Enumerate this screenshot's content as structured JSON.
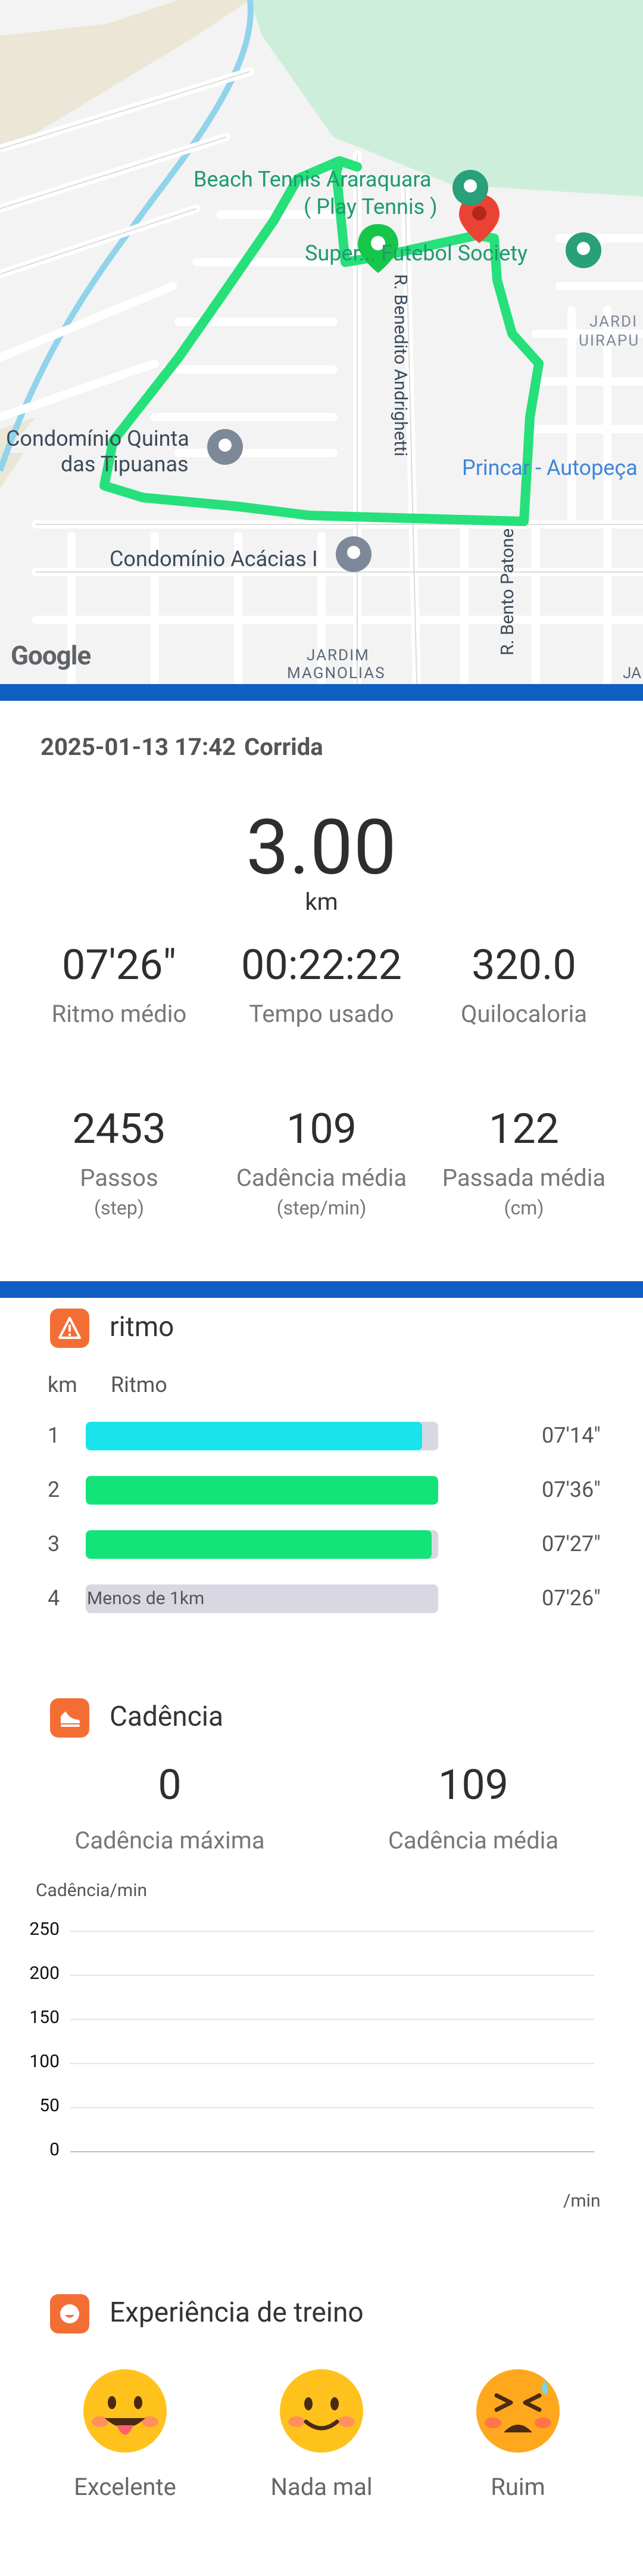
{
  "map": {
    "labels": {
      "beach": "Beach Tennis Araraquara",
      "play": "( Play Tennis )",
      "futebol": "Super... Futebol Society",
      "benedito": "R. Benedito Andrighetti",
      "jardim_uira": "JARDI",
      "jardim_uira2": "UIRAPU",
      "condominio_quinta": "Condomínio Quinta",
      "das_tipuanas": "das Tipuanas",
      "princar": "Princar - Autopeça",
      "acacias": "Condomínio Acácias I",
      "bento": "R. Bento Patone",
      "jardim_mag1": "JARDIM",
      "jardim_mag2": "MAGNOLIAS",
      "ja": "JA",
      "google": "Google"
    }
  },
  "workout": {
    "date": "2025-01-13 17:42",
    "type": "Corrida",
    "distance": "3.00",
    "distance_unit": "km"
  },
  "stats": [
    {
      "value": "07'26\"",
      "label": "Ritmo médio",
      "unit": ""
    },
    {
      "value": "00:22:22",
      "label": "Tempo usado",
      "unit": ""
    },
    {
      "value": "320.0",
      "label": "Quilocaloria",
      "unit": ""
    },
    {
      "value": "2453",
      "label": "Passos",
      "unit": "(step)"
    },
    {
      "value": "109",
      "label": "Cadência média",
      "unit": "(step/min)"
    },
    {
      "value": "122",
      "label": "Passada média",
      "unit": "(cm)"
    }
  ],
  "pace": {
    "title": "ritmo",
    "col_km": "km",
    "col_pace": "Ritmo",
    "rows": [
      {
        "km": "1",
        "value": "07'14\"",
        "fill": 0.955,
        "color": "#19e4ec",
        "note": ""
      },
      {
        "km": "2",
        "value": "07'36\"",
        "fill": 1.0,
        "color": "#12e47a",
        "note": ""
      },
      {
        "km": "3",
        "value": "07'27\"",
        "fill": 0.982,
        "color": "#12e47a",
        "note": ""
      },
      {
        "km": "4",
        "value": "07'26\"",
        "fill": 0,
        "color": "#12e47a",
        "note": "Menos de 1km"
      }
    ]
  },
  "cadence": {
    "title": "Cadência",
    "max_value": "0",
    "max_label": "Cadência máxima",
    "avg_value": "109",
    "avg_label": "Cadência média",
    "chart": {
      "ylabel": "Cadência/min",
      "yticks": [
        "250",
        "200",
        "150",
        "100",
        "50",
        "0"
      ],
      "xunit": "/min"
    }
  },
  "experience": {
    "title": "Experiência de treino",
    "options": [
      {
        "label": "Excelente",
        "icon": "tongue-face-icon"
      },
      {
        "label": "Nada mal",
        "icon": "smile-face-icon"
      },
      {
        "label": "Ruim",
        "icon": "tired-face-icon"
      }
    ]
  },
  "colors": {
    "route": "#26e07a",
    "accent_bar": "#0f5ec2",
    "section_icon": "#f26e35"
  }
}
